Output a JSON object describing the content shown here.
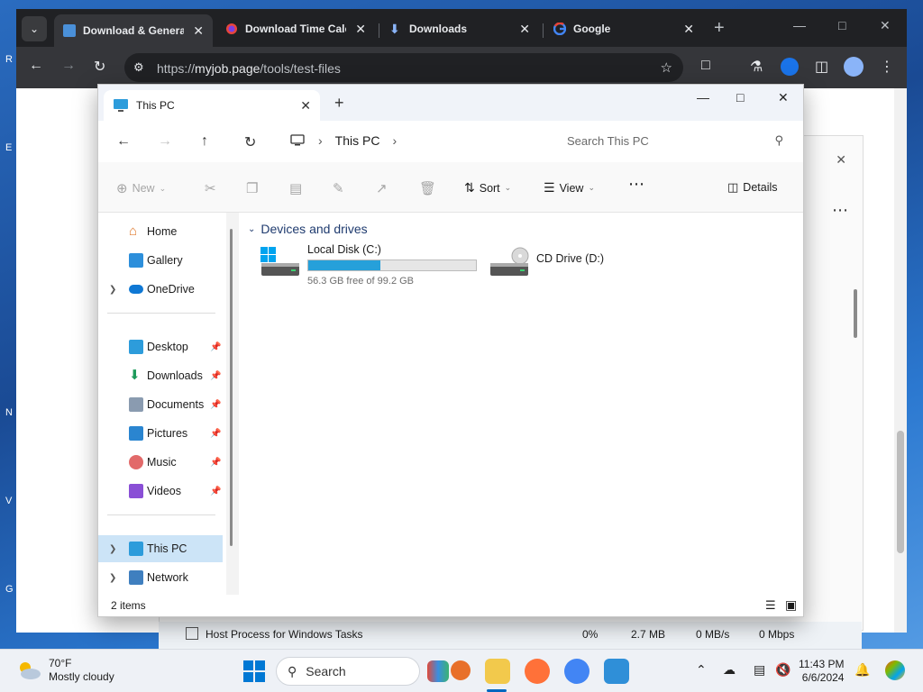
{
  "browser": {
    "tabs": [
      {
        "title": "Download & Genera",
        "active": true
      },
      {
        "title": "Download Time Calc",
        "active": false
      },
      {
        "title": "Downloads",
        "active": false
      },
      {
        "title": "Google",
        "active": false
      }
    ],
    "url_scheme": "https://",
    "url_host": "myjob.page",
    "url_path": "/tools/test-files"
  },
  "explorer": {
    "tab_title": "This PC",
    "breadcrumb": "This PC",
    "search_placeholder": "Search This PC",
    "commands": {
      "new": "New",
      "sort": "Sort",
      "view": "View",
      "details": "Details"
    },
    "sidebar": {
      "top": [
        "Home",
        "Gallery",
        "OneDrive"
      ],
      "pinned": [
        "Desktop",
        "Downloads",
        "Documents",
        "Pictures",
        "Music",
        "Videos"
      ],
      "bottom": [
        "This PC",
        "Network"
      ]
    },
    "group_title": "Devices and drives",
    "drives": [
      {
        "name": "Local Disk (C:)",
        "free_text": "56.3 GB free of 99.2 GB",
        "used_fraction": 0.43
      },
      {
        "name": "CD Drive (D:)"
      }
    ],
    "status_count": "2 items"
  },
  "background_process": {
    "name": "Host Process for Windows Tasks",
    "cpu": "0%",
    "memory": "2.7 MB",
    "disk": "0 MB/s",
    "network": "0 Mbps"
  },
  "taskbar": {
    "temperature": "70°F",
    "condition": "Mostly cloudy",
    "search_label": "Search",
    "time": "11:43 PM",
    "date": "6/6/2024"
  }
}
